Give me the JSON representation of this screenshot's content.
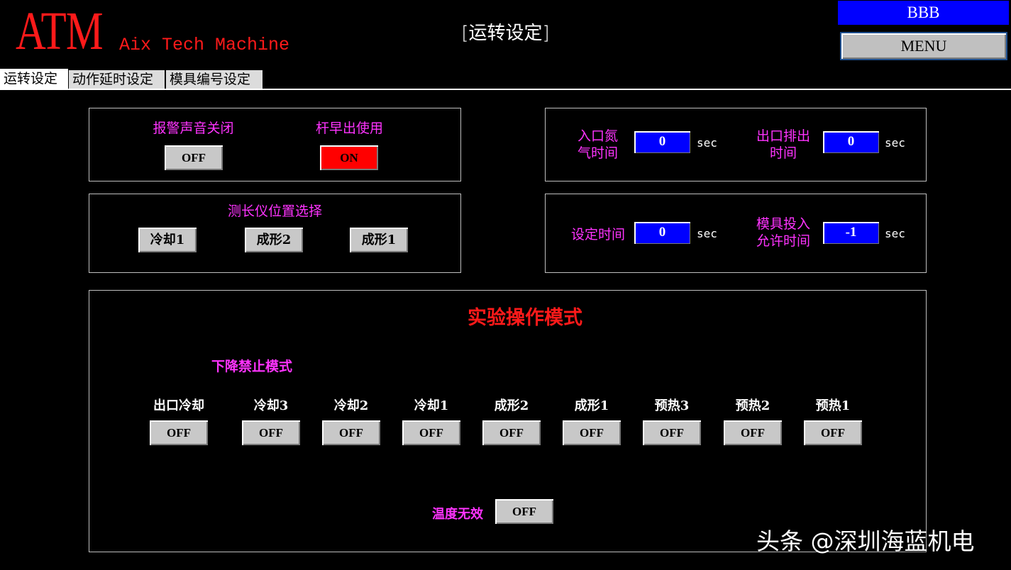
{
  "header": {
    "logo": "ATM",
    "logo_subtitle": "Aix Tech Machine",
    "screen_title": "[运转设定]",
    "user_badge": "BBB",
    "menu_label": "MENU"
  },
  "tabs": [
    {
      "label": "运转设定",
      "active": true
    },
    {
      "label": "动作延时设定",
      "active": false
    },
    {
      "label": "模具编号设定",
      "active": false
    }
  ],
  "alarm_panel": {
    "alarm_label": "报警声音关闭",
    "alarm_state": "OFF",
    "rod_label": "杆早出使用",
    "rod_state": "ON"
  },
  "gauge_panel": {
    "title": "测长仪位置选择",
    "options": [
      "冷却1",
      "成形2",
      "成形1"
    ]
  },
  "time_panel_1": {
    "inlet_label_l1": "入口氮",
    "inlet_label_l2": "气时间",
    "inlet_value": "0",
    "inlet_unit": "sec",
    "outlet_label_l1": "出口排出",
    "outlet_label_l2": "时间",
    "outlet_value": "0",
    "outlet_unit": "sec"
  },
  "time_panel_2": {
    "set_time_label": "设定时间",
    "set_time_value": "0",
    "set_time_unit": "sec",
    "mold_label_l1": "模具投入",
    "mold_label_l2": "允许时间",
    "mold_value": "-1",
    "mold_unit": "sec"
  },
  "experiment": {
    "title": "实验操作模式",
    "subtitle": "下降禁止模式",
    "stations": [
      {
        "label": "出口冷却",
        "state": "OFF"
      },
      {
        "label": "冷却3",
        "state": "OFF"
      },
      {
        "label": "冷却2",
        "state": "OFF"
      },
      {
        "label": "冷却1",
        "state": "OFF"
      },
      {
        "label": "成形2",
        "state": "OFF"
      },
      {
        "label": "成形1",
        "state": "OFF"
      },
      {
        "label": "预热3",
        "state": "OFF"
      },
      {
        "label": "预热2",
        "state": "OFF"
      },
      {
        "label": "预热1",
        "state": "OFF"
      }
    ],
    "temp_label": "温度无效",
    "temp_state": "OFF"
  },
  "watermark": "头条 @深圳海蓝机电",
  "colors": {
    "background": "#000000",
    "logo": "#ff1a1a",
    "label_magenta": "#ff33ff",
    "value_box": "#0000ff",
    "on_button": "#ff0000",
    "off_button": "#c8c8c8",
    "title_red": "#ff1a1a"
  }
}
